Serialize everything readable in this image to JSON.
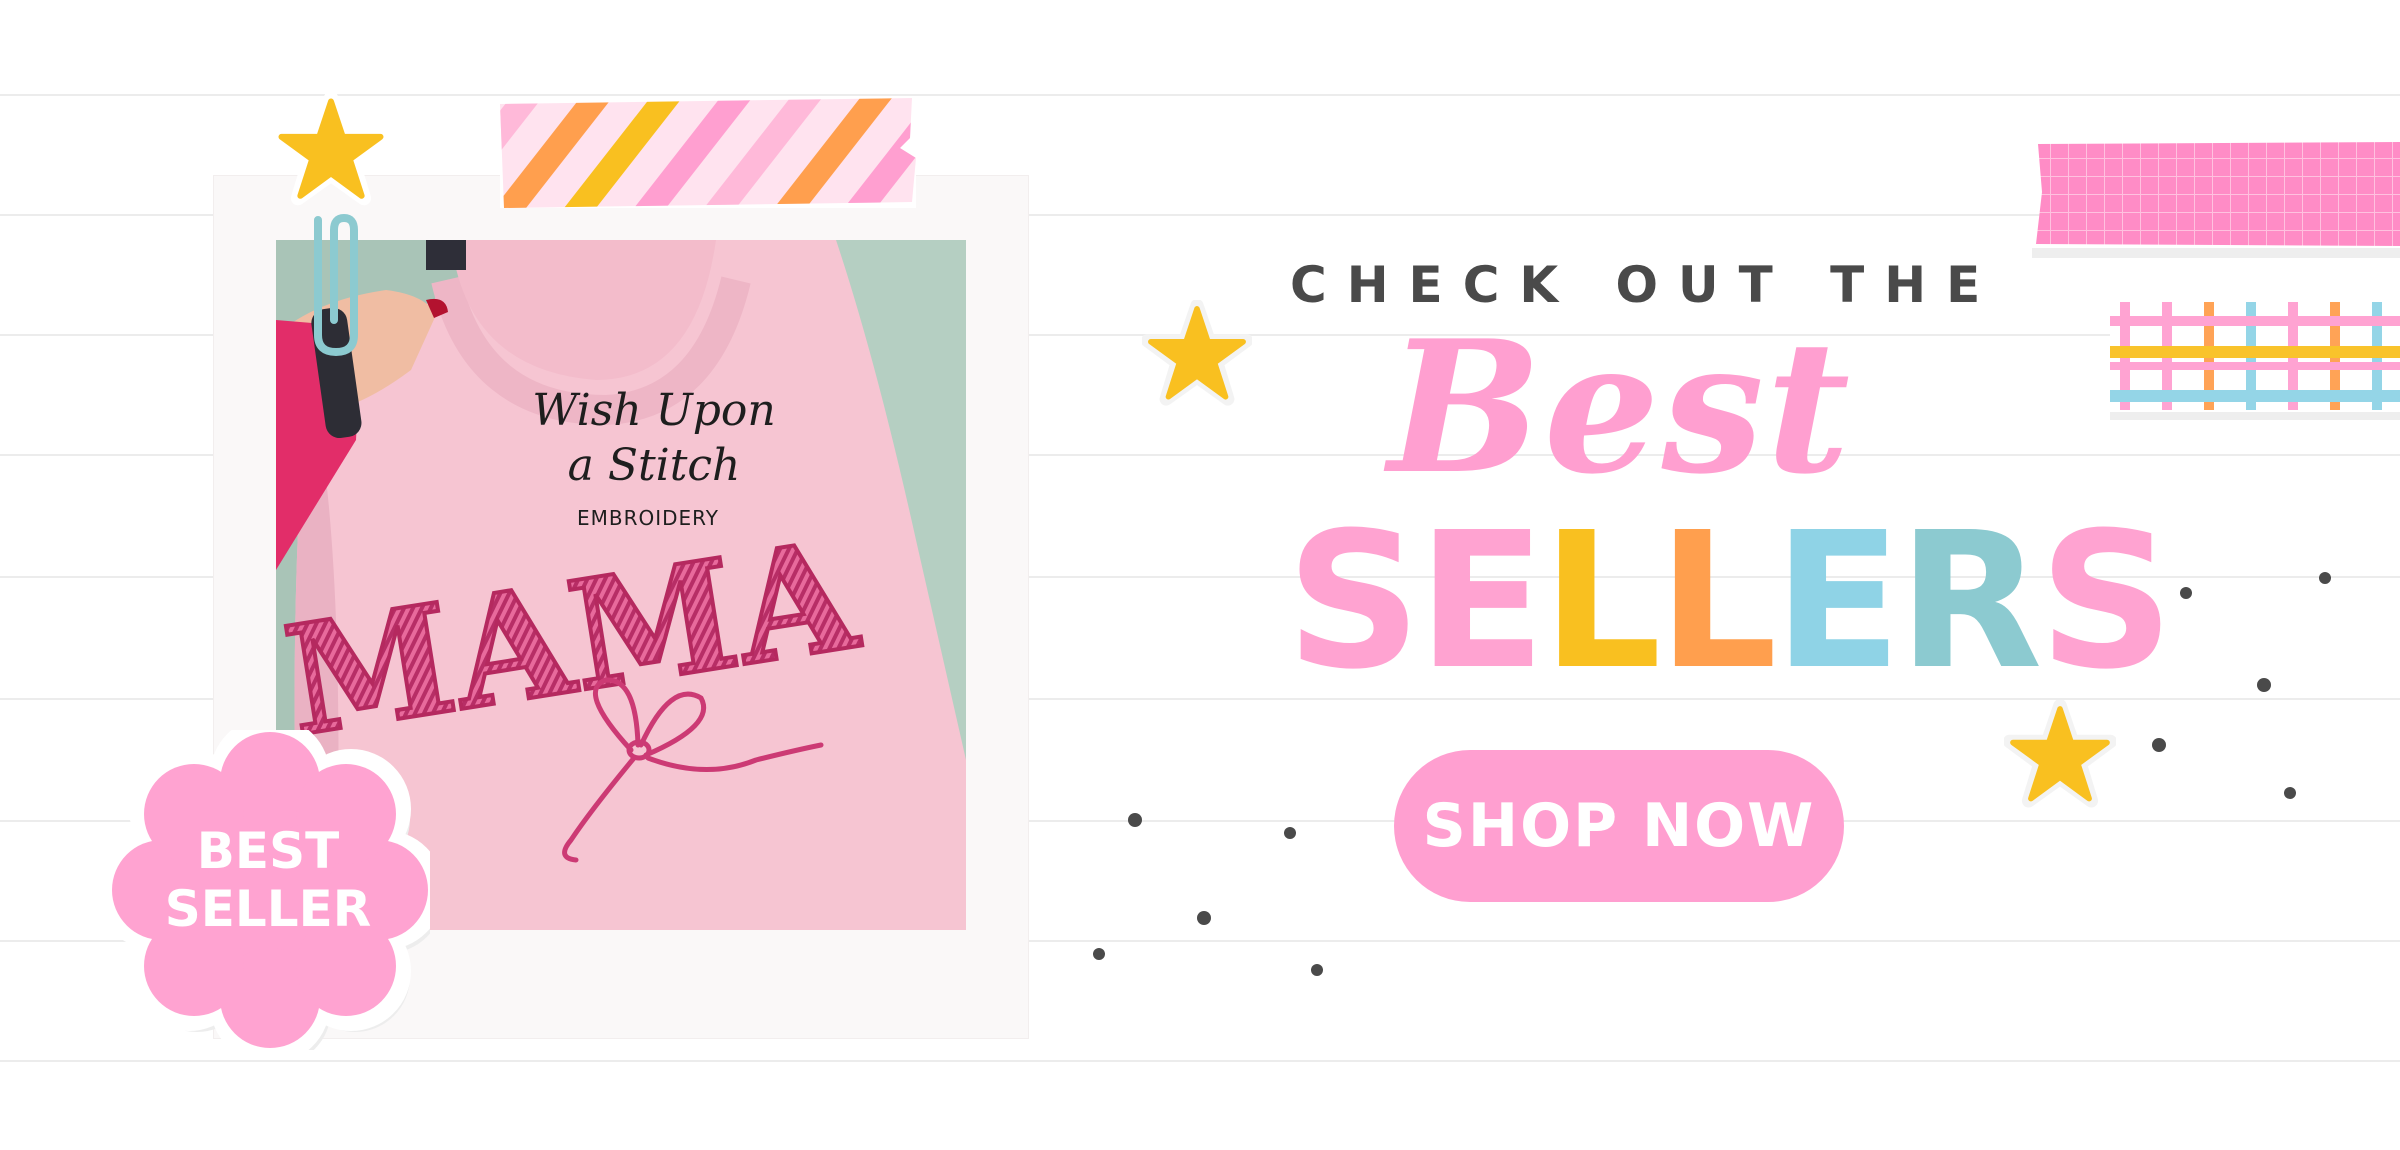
{
  "banner": {
    "eyebrow": "CHECK OUT THE",
    "headline_line1": "Best",
    "headline_line2_letters": [
      "S",
      "E",
      "L",
      "L",
      "E",
      "R",
      "S"
    ],
    "headline_line2_colors": [
      "#ffa3d1",
      "#ffa3d1",
      "#f9c020",
      "#ff9f4e",
      "#8fd3e6",
      "#8ccad0",
      "#ffa3d1"
    ],
    "cta_label": "SHOP NOW",
    "badge_line1": "BEST",
    "badge_line2": "SELLER"
  },
  "product_photo": {
    "shirt_text": "MAMA",
    "logo_line1": "Wish Upon",
    "logo_line2": "a Stitch",
    "logo_line3": "EMBROIDERY"
  },
  "colors": {
    "pink": "#ffa3d1",
    "yellow": "#f9c020",
    "orange": "#ff9f4e",
    "blue": "#8fd3e6",
    "teal": "#8ccad0",
    "dark_text": "#4a4a4a",
    "shirt_pink": "#f6c5d2",
    "embroidery_pink": "#d9467f"
  }
}
